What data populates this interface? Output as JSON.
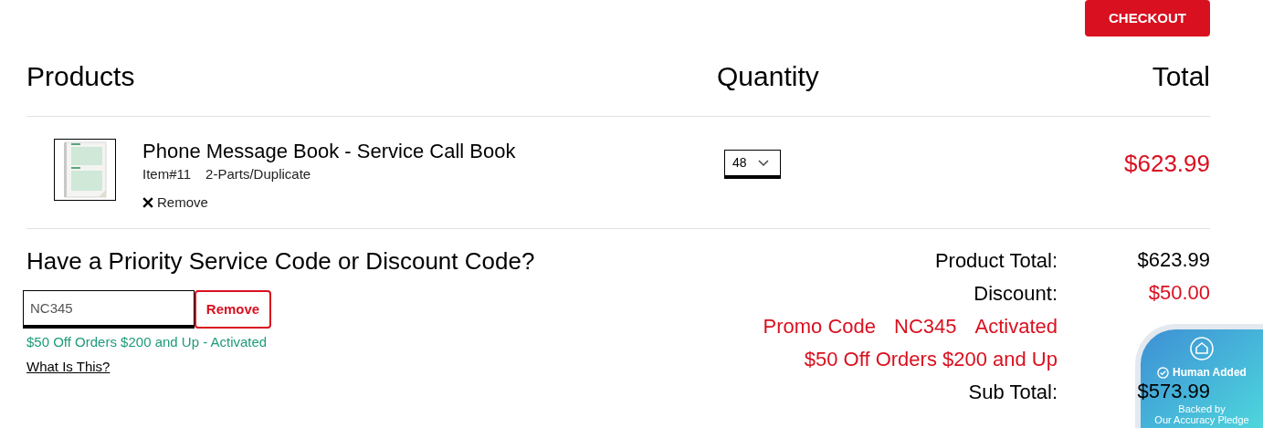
{
  "checkout_button": "CHECKOUT",
  "columns": [
    "Products",
    "Quantity",
    "Total"
  ],
  "items": [
    {
      "name": "Phone Message Book - Service Call Book",
      "item_no": "Item#11",
      "variant": "2-Parts/Duplicate",
      "remove": "Remove",
      "quantity": "48",
      "total": "$623.99"
    }
  ],
  "promo": {
    "heading": "Have a Priority Service Code or Discount Code?",
    "value": "NC345",
    "remove_button": "Remove",
    "status": "$50 Off Orders $200 and Up - Activated",
    "help_link": "What Is This?"
  },
  "summary": [
    {
      "kind": "line",
      "label": "Product Total:",
      "value": "$623.99"
    },
    {
      "kind": "discount",
      "label": "Discount:",
      "value": "$50.00"
    },
    {
      "kind": "note",
      "parts": [
        "Promo Code",
        "NC345",
        "Activated"
      ]
    },
    {
      "kind": "note",
      "parts": [
        "$50 Off Orders $200 and Up"
      ]
    },
    {
      "kind": "line",
      "label": "Sub Total:",
      "value": "$573.99"
    }
  ],
  "badge": {
    "title": "Human Added",
    "subtitle": [
      "Backed by",
      "Our Accuracy Pledge"
    ]
  }
}
